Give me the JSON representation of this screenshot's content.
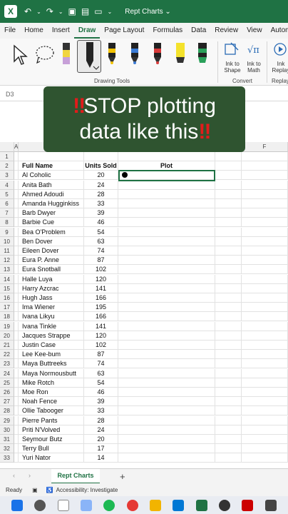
{
  "title_bar": {
    "doc_title": "Rept Charts ⌄"
  },
  "tabs": [
    "File",
    "Home",
    "Insert",
    "Draw",
    "Page Layout",
    "Formulas",
    "Data",
    "Review",
    "View",
    "Automate"
  ],
  "active_tab": "Draw",
  "ribbon": {
    "drawing_tools_label": "Drawing Tools",
    "convert_label": "Convert",
    "replay_label": "Replay",
    "ink_to_shape": "Ink to\nShape",
    "ink_to_math": "Ink to\nMath",
    "ink_replay": "Ink\nReplay"
  },
  "name_box": "D3",
  "banner": {
    "line1": "STOP plotting",
    "line2": "data like this",
    "bang": "‼"
  },
  "columns": [
    "A",
    "F"
  ],
  "headers": {
    "name": "Full Name",
    "units": "Units Sold",
    "plot": "Plot"
  },
  "rows": [
    {
      "n": 3,
      "name": "Al Coholic",
      "units": 20
    },
    {
      "n": 4,
      "name": "Anita Bath",
      "units": 24
    },
    {
      "n": 5,
      "name": "Ahmed Adoudi",
      "units": 28
    },
    {
      "n": 6,
      "name": "Amanda Hugginkiss",
      "units": 33
    },
    {
      "n": 7,
      "name": "Barb Dwyer",
      "units": 39
    },
    {
      "n": 8,
      "name": "Barbie Cue",
      "units": 46
    },
    {
      "n": 9,
      "name": "Bea O'Problem",
      "units": 54
    },
    {
      "n": 10,
      "name": "Ben Dover",
      "units": 63
    },
    {
      "n": 11,
      "name": "Eileen Dover",
      "units": 74
    },
    {
      "n": 12,
      "name": "Eura P. Anne",
      "units": 87
    },
    {
      "n": 13,
      "name": "Eura Snotball",
      "units": 102
    },
    {
      "n": 14,
      "name": "Halle Luya",
      "units": 120
    },
    {
      "n": 15,
      "name": "Harry Azcrac",
      "units": 141
    },
    {
      "n": 16,
      "name": "Hugh Jass",
      "units": 166
    },
    {
      "n": 17,
      "name": "Ima Wiener",
      "units": 195
    },
    {
      "n": 18,
      "name": "Ivana Likyu",
      "units": 166
    },
    {
      "n": 19,
      "name": "Ivana Tinkle",
      "units": 141
    },
    {
      "n": 20,
      "name": "Jacques Strappe",
      "units": 120
    },
    {
      "n": 21,
      "name": "Justin Case",
      "units": 102
    },
    {
      "n": 22,
      "name": "Lee Kee-bum",
      "units": 87
    },
    {
      "n": 23,
      "name": "Maya Buttreeks",
      "units": 74
    },
    {
      "n": 24,
      "name": "Maya Normousbutt",
      "units": 63
    },
    {
      "n": 25,
      "name": "Mike Rotch",
      "units": 54
    },
    {
      "n": 26,
      "name": "Moe Ron",
      "units": 46
    },
    {
      "n": 27,
      "name": "Noah Fence",
      "units": 39
    },
    {
      "n": 28,
      "name": "Ollie Tabooger",
      "units": 33
    },
    {
      "n": 29,
      "name": "Pierre Pants",
      "units": 28
    },
    {
      "n": 30,
      "name": "Priti N'Volved",
      "units": 24
    },
    {
      "n": 31,
      "name": "Seymour Butz",
      "units": 20
    },
    {
      "n": 32,
      "name": "Terry Bull",
      "units": 17
    },
    {
      "n": 33,
      "name": "Yuri Nator",
      "units": 14
    }
  ],
  "sheet_tab": "Rept Charts",
  "status": {
    "ready": "Ready",
    "accessibility": "Accessibility: Investigate"
  },
  "colors": {
    "excel_green": "#1f7244",
    "banner_bg": "#2f5430",
    "bang_red": "#e21b1b"
  }
}
